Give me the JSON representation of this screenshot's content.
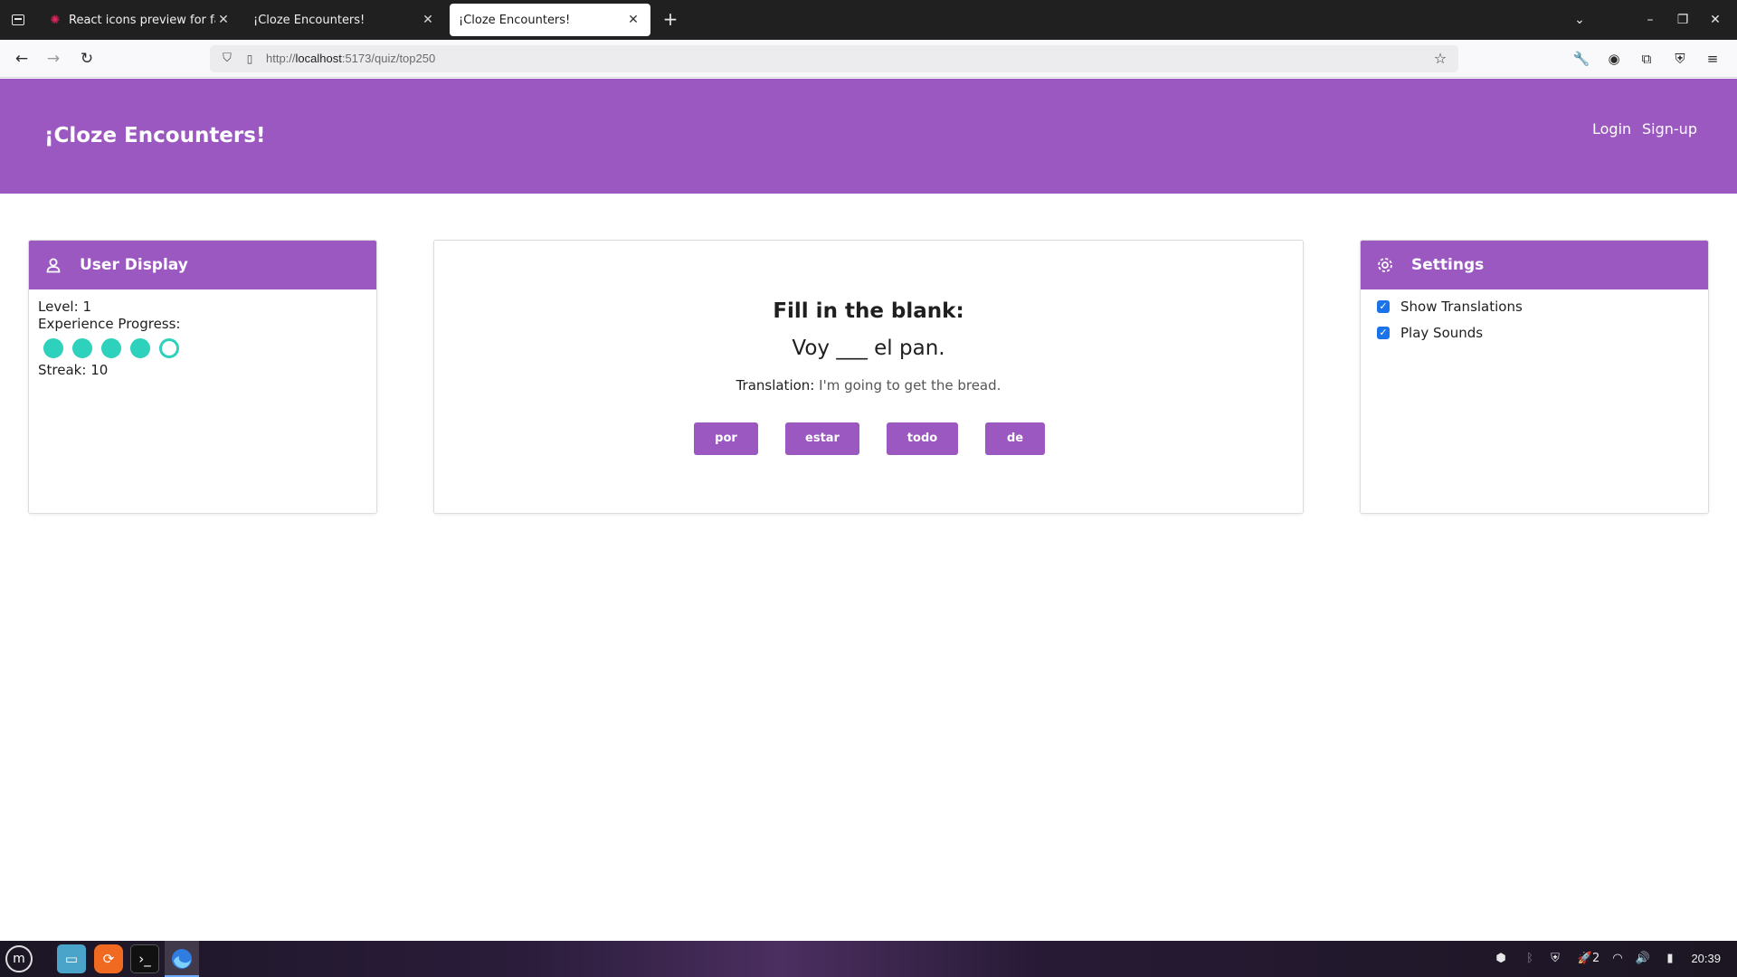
{
  "browser": {
    "tabs": [
      {
        "title": "React icons preview for fa",
        "active": false
      },
      {
        "title": "¡Cloze Encounters!",
        "active": false
      },
      {
        "title": "¡Cloze Encounters!",
        "active": true
      }
    ],
    "url_scheme": "http://",
    "url_host": "localhost",
    "url_path": ":5173/quiz/top250"
  },
  "header": {
    "brand": "¡Cloze Encounters!",
    "login": "Login",
    "signup": "Sign-up",
    "color": "#9a58c0"
  },
  "user_display": {
    "title": "User Display",
    "level_label": "Level:",
    "level_value": "1",
    "progress_label": "Experience Progress:",
    "progress_filled": 4,
    "progress_total": 5,
    "streak_label": "Streak:",
    "streak_value": "10"
  },
  "quiz": {
    "title": "Fill in the blank:",
    "sentence": "Voy ___ el pan.",
    "translation_label": "Translation:",
    "translation_value": "I'm going to get the bread.",
    "answers": [
      "por",
      "estar",
      "todo",
      "de"
    ]
  },
  "settings": {
    "title": "Settings",
    "options": [
      {
        "label": "Show Translations",
        "checked": true
      },
      {
        "label": "Play Sounds",
        "checked": true
      }
    ]
  },
  "taskbar": {
    "clock": "20:39",
    "notification_count": "2"
  },
  "colors": {
    "accent": "#9a58c0",
    "progress": "#2ed1bb",
    "checkbox": "#1a73e8"
  }
}
